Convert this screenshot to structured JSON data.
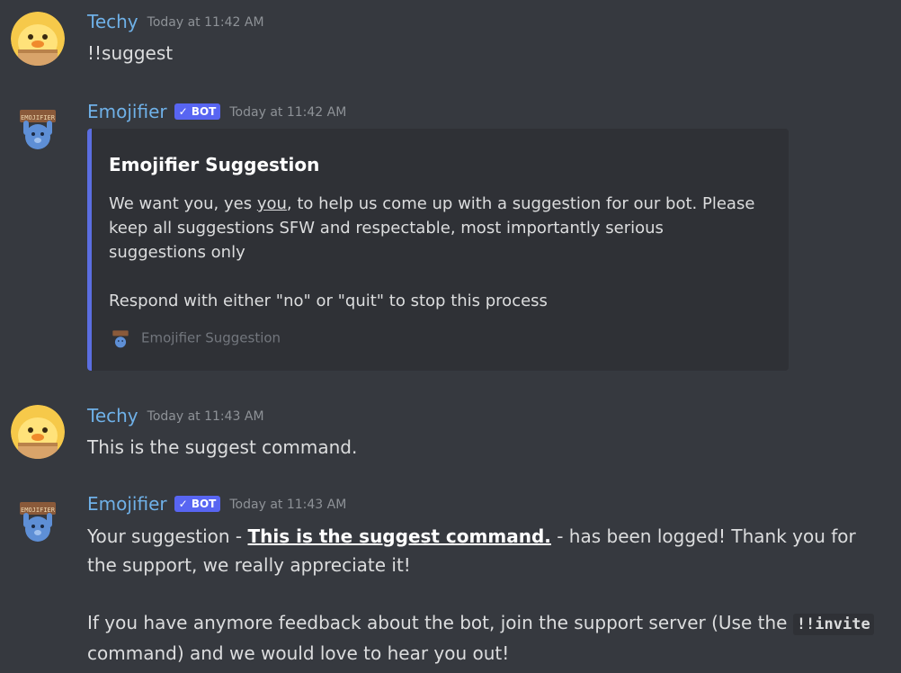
{
  "messages": [
    {
      "username": "Techy",
      "timestamp": "Today at 11:42 AM",
      "content": "!!suggest"
    },
    {
      "username": "Emojifier",
      "badge": "BOT",
      "timestamp": "Today at 11:42 AM",
      "embed": {
        "title": "Emojifier Suggestion",
        "desc_pre": "We want you, yes ",
        "desc_underline": "you",
        "desc_post": ", to help us come up with a suggestion for our bot. Please keep all suggestions SFW and respectable, most importantly serious suggestions only",
        "desc_line2": "Respond with either \"no\" or \"quit\" to stop this process",
        "footer": "Emojifier Suggestion"
      }
    },
    {
      "username": "Techy",
      "timestamp": "Today at 11:43 AM",
      "content": "This is the suggest command."
    },
    {
      "username": "Emojifier",
      "badge": "BOT",
      "timestamp": "Today at 11:43 AM",
      "para1_pre": "Your suggestion - ",
      "para1_bold": "This is the suggest command.",
      "para1_post": " - has been logged! Thank you for the support, we really appreciate it!",
      "para2_pre": "If you have anymore feedback about the bot, join the support server (Use the ",
      "para2_code": "!!invite",
      "para2_post": " command) and we would love to hear you out!"
    }
  ],
  "colors": {
    "background": "#36393f",
    "username": "#6fb1e8",
    "bot_badge": "#5865f2",
    "embed_border": "#5b6ee1",
    "embed_bg": "#2f3136"
  },
  "icons": {
    "techy_avatar": "duck-avatar-icon",
    "bot_avatar": "emojifier-bot-avatar-icon",
    "verified": "checkmark-icon"
  }
}
